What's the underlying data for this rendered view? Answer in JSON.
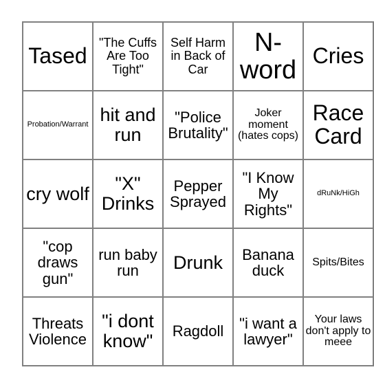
{
  "card": {
    "type": "bingo-card",
    "rows": 5,
    "columns": 5,
    "border_color": "#808080",
    "background_color": "#ffffff",
    "text_color": "#000000",
    "cells": [
      [
        {
          "text": "Tased",
          "size": "fs-xl"
        },
        {
          "text": "\"The Cuffs Are Too Tight\"",
          "size": "fs-sm"
        },
        {
          "text": "Self Harm in Back of Car",
          "size": "fs-sm"
        },
        {
          "text": "N-word",
          "size": "fs-xxl"
        },
        {
          "text": "Cries",
          "size": "fs-xl"
        }
      ],
      [
        {
          "text": "Probation/Warrant",
          "size": "fs-xxs"
        },
        {
          "text": "hit and run",
          "size": "fs-lg"
        },
        {
          "text": "\"Police Brutality\"",
          "size": "fs-md"
        },
        {
          "text": "Joker moment (hates cops)",
          "size": "fs-xs"
        },
        {
          "text": "Race Card",
          "size": "fs-xl"
        }
      ],
      [
        {
          "text": "cry wolf",
          "size": "fs-lg"
        },
        {
          "text": "\"X\" Drinks",
          "size": "fs-lg"
        },
        {
          "text": "Pepper Sprayed",
          "size": "fs-md"
        },
        {
          "text": "\"I Know My Rights\"",
          "size": "fs-md"
        },
        {
          "text": "dRuNk/HiGh",
          "size": "fs-xxs"
        }
      ],
      [
        {
          "text": "\"cop draws gun\"",
          "size": "fs-md"
        },
        {
          "text": "run baby run",
          "size": "fs-md"
        },
        {
          "text": "Drunk",
          "size": "fs-lg"
        },
        {
          "text": "Banana duck",
          "size": "fs-md"
        },
        {
          "text": "Spits/Bites",
          "size": "fs-xs"
        }
      ],
      [
        {
          "text": "Threats Violence",
          "size": "fs-md"
        },
        {
          "text": "\"i dont know\"",
          "size": "fs-lg"
        },
        {
          "text": "Ragdoll",
          "size": "fs-md"
        },
        {
          "text": "\"i want a lawyer\"",
          "size": "fs-md"
        },
        {
          "text": "Your laws don't apply to meee",
          "size": "fs-xs"
        }
      ]
    ]
  }
}
